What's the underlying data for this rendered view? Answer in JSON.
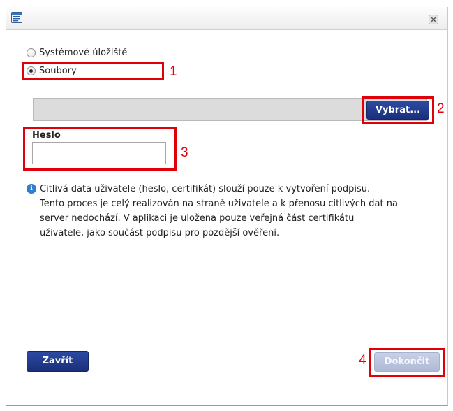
{
  "dialog": {
    "window_icon": "document-window-icon",
    "close_icon": "close-icon"
  },
  "options": {
    "system_storage_label": "Systémové úložiště",
    "files_label": "Soubory",
    "selected": "Soubory"
  },
  "file_picker": {
    "value": "",
    "browse_label": "Vybrat..."
  },
  "password": {
    "label": "Heslo",
    "value": ""
  },
  "info": {
    "icon": "info-icon",
    "lines": [
      "Citlivá data uživatele (heslo, certifikát) slouží pouze k vytvoření podpisu.",
      "Tento proces je celý realizován na straně uživatele a k přenosu citlivých dat na",
      "server nedochází. V aplikaci je uložena pouze veřejná část certifikátu",
      "uživatele, jako součást podpisu pro pozdější ověření."
    ]
  },
  "buttons": {
    "close_label": "Zavřít",
    "finish_label": "Dokončit"
  },
  "annotations": [
    "1",
    "2",
    "3",
    "4"
  ],
  "colors": {
    "annotation_red": "#e0000a",
    "button_blue": "#1f3a8f",
    "button_disabled": "#b8c2dc"
  }
}
